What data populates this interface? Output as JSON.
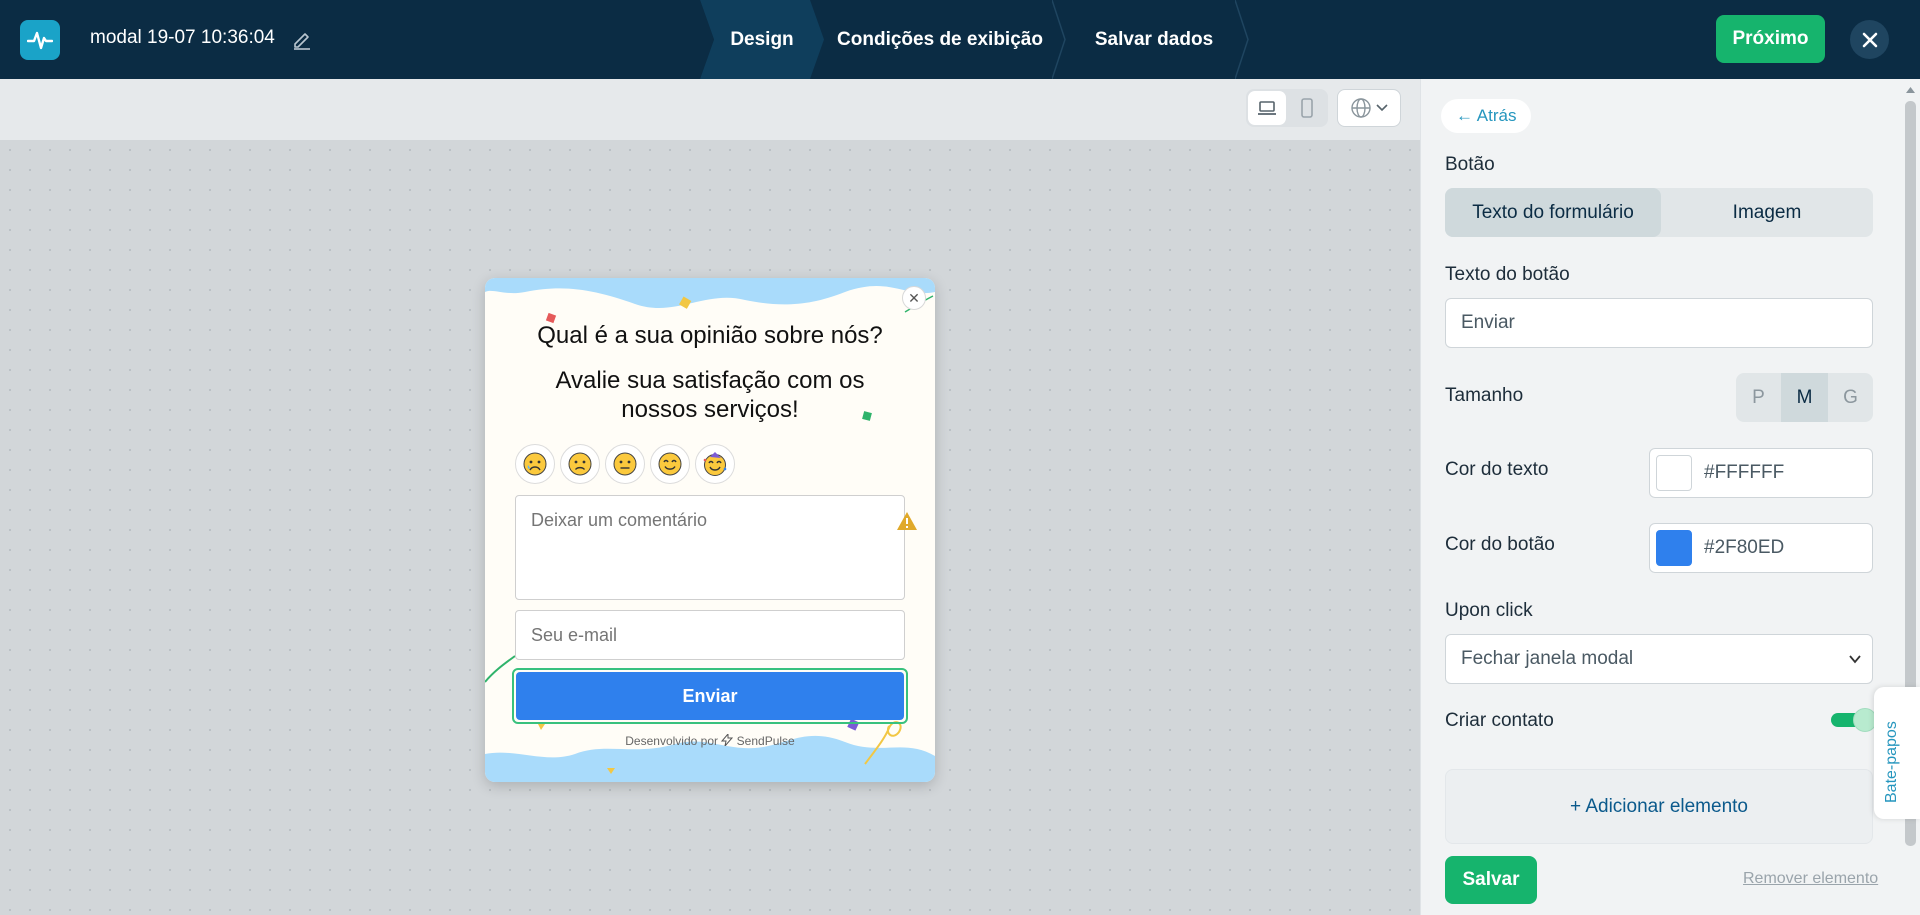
{
  "topbar": {
    "doc_title": "modal 19-07 10:36:04",
    "steps": [
      {
        "label": "Design",
        "active": true
      },
      {
        "label": "Condições de exibição",
        "active": false
      },
      {
        "label": "Salvar dados",
        "active": false
      }
    ],
    "next_label": "Próximo"
  },
  "modal": {
    "title": "Qual é a sua opinião sobre nós?",
    "subtitle": "Avalie sua satisfação com os nossos serviços!",
    "emojis": [
      "😥",
      "😟",
      "😐",
      "😊",
      "🥳"
    ],
    "comment_placeholder": "Deixar um comentário",
    "email_placeholder": "Seu e-mail",
    "button_label": "Enviar",
    "powered_prefix": "Desenvolvido por",
    "powered_brand": "SendPulse"
  },
  "panel": {
    "back_label": "← Atrás",
    "section_label": "Botão",
    "tabs": [
      {
        "label": "Texto do formulário",
        "active": true
      },
      {
        "label": "Imagem",
        "active": false
      }
    ],
    "button_text_label": "Texto do botão",
    "button_text_value": "Enviar",
    "size_label": "Tamanho",
    "sizes": [
      {
        "label": "P",
        "active": false
      },
      {
        "label": "M",
        "active": true
      },
      {
        "label": "G",
        "active": false
      }
    ],
    "text_color_label": "Cor do texto",
    "text_color_value": "#FFFFFF",
    "button_color_label": "Cor do botão",
    "button_color_value": "#2F80ED",
    "upon_click_label": "Upon click",
    "upon_click_value": "Fechar janela modal",
    "create_contact_label": "Criar contato",
    "create_contact_on": true,
    "add_element_label": "+ Adicionar elemento",
    "save_label": "Salvar",
    "remove_label": "Remover elemento"
  },
  "chat_tab_label": "Bate-papos",
  "colors": {
    "topbar_bg": "#0B2C44",
    "accent_green": "#16B46D",
    "button_blue": "#2F80ED",
    "link_blue": "#2596BE"
  }
}
